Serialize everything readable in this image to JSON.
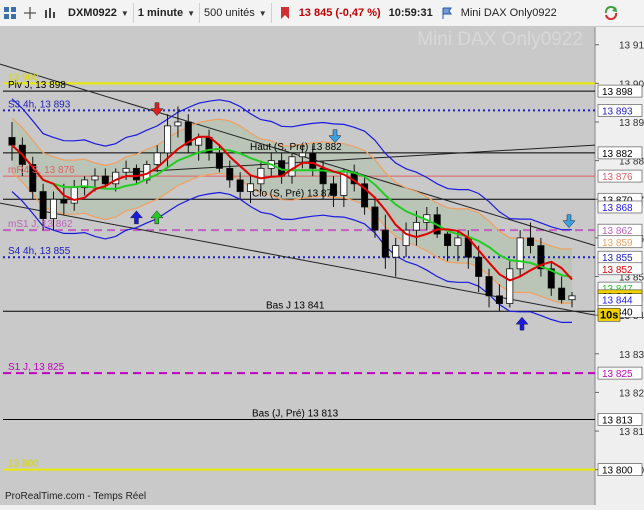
{
  "toolbar": {
    "symbol": "DXM0922",
    "timeframe": "1 minute",
    "units": "500 unités",
    "price": "13 845",
    "change": "(-0,47 %)",
    "time": "10:59:31",
    "instrument": "Mini DAX Only0922",
    "icons": [
      "grid-icon",
      "crosshair-icon",
      "bars-icon",
      "bookmark-icon",
      "refresh-icon"
    ]
  },
  "chart": {
    "watermark": "Mini DAX Only0922",
    "footer": "ProRealTime.com - Temps Réel",
    "timer": "10s",
    "colors": {
      "background": "#c9c9c9",
      "axis_bg": "#efefef",
      "candle_up": "#ffffff",
      "candle_down": "#000000",
      "ma_red": "#e00000",
      "ma_green": "#22cc22",
      "band_blue": "#1a1ae0",
      "band_orange": "#f0a060",
      "cloud": "#b7c4b4",
      "support_line": "#2020c0",
      "magenta_line": "#c000c0",
      "yellow_line": "#ffff40",
      "red_line": "#e06060"
    }
  },
  "chart_data": {
    "type": "candlestick",
    "ylim": [
      13795,
      13912
    ],
    "price_ticks": [
      13910,
      13900,
      13890,
      13880,
      13870,
      13860,
      13850,
      13840,
      13830,
      13820,
      13810,
      13800
    ],
    "levels": [
      {
        "name": "Piv J",
        "label": "Piv J, 13 898",
        "value": 13898,
        "color": "#000000",
        "style": "solid",
        "axis_label": "13 898"
      },
      {
        "name": "R top",
        "label": "13 900",
        "value": 13900,
        "color": "#e8e800",
        "style": "solid",
        "axis_label": ""
      },
      {
        "name": "S3 4h",
        "label": "S3 4h, 13 893",
        "value": 13893,
        "color": "#2020c0",
        "style": "dotted",
        "axis_label": "13 893"
      },
      {
        "name": "Haut (S, Pré)",
        "label": "Haut (S, Pré) 13 882",
        "value": 13882,
        "color": "#000000",
        "style": "solid",
        "axis_label": "13 882"
      },
      {
        "name": "mR4",
        "label": "mR4 S, 13 876",
        "value": 13876,
        "color": "#e06060",
        "style": "solid",
        "axis_label": "13 876"
      },
      {
        "name": "Clo (S, Pré)",
        "label": "Clo (S, Pré) 13 870",
        "value": 13870,
        "color": "#000000",
        "style": "solid",
        "axis_label": "13 870"
      },
      {
        "name": "mS1",
        "label": "mS1 J, 13 862",
        "value": 13862,
        "color": "#c060c0",
        "style": "dashed",
        "axis_label": "13 862"
      },
      {
        "name": "S4 4h",
        "label": "S4 4h, 13 855",
        "value": 13855,
        "color": "#2020c0",
        "style": "dotted",
        "axis_label": "13 855"
      },
      {
        "name": "Bas J",
        "label": "Bas J 13 841",
        "value": 13841,
        "color": "#000000",
        "style": "solid",
        "axis_label": "13 840"
      },
      {
        "name": "S1 J",
        "label": "S1 J, 13 825",
        "value": 13825,
        "color": "#c000c0",
        "style": "dashed",
        "axis_label": "13 825"
      },
      {
        "name": "Bas (J, Pré)",
        "label": "Bas (J, Pré) 13 813",
        "value": 13813,
        "color": "#000000",
        "style": "solid",
        "axis_label": "13 813"
      },
      {
        "name": "Y bottom",
        "label": "13 800",
        "value": 13800,
        "color": "#e8e800",
        "style": "solid",
        "axis_label": "13 800"
      }
    ],
    "side_labels": [
      {
        "value": 13868,
        "text": "13 868",
        "color": "#1a1ae0"
      },
      {
        "value": 13859,
        "text": "13 859",
        "color": "#f0a060"
      },
      {
        "value": 13852,
        "text": "13 852",
        "color": "#e00000"
      },
      {
        "value": 13847,
        "text": "13 847",
        "color": "#22cc22"
      },
      {
        "value": 13845,
        "text": "13 845",
        "color": "#f0d000"
      },
      {
        "value": 13844,
        "text": "13 844",
        "color": "#1a1ae0"
      }
    ],
    "candles": [
      [
        13886,
        13890,
        13880,
        13884
      ],
      [
        13884,
        13886,
        13876,
        13879
      ],
      [
        13879,
        13881,
        13870,
        13872
      ],
      [
        13872,
        13874,
        13862,
        13865
      ],
      [
        13865,
        13872,
        13862,
        13870
      ],
      [
        13870,
        13874,
        13866,
        13869
      ],
      [
        13869,
        13875,
        13867,
        13873
      ],
      [
        13873,
        13876,
        13871,
        13875
      ],
      [
        13875,
        13878,
        13872,
        13876
      ],
      [
        13876,
        13878,
        13873,
        13874
      ],
      [
        13874,
        13878,
        13872,
        13877
      ],
      [
        13877,
        13880,
        13875,
        13878
      ],
      [
        13878,
        13879,
        13874,
        13875
      ],
      [
        13875,
        13880,
        13874,
        13879
      ],
      [
        13879,
        13884,
        13877,
        13882
      ],
      [
        13882,
        13892,
        13878,
        13889
      ],
      [
        13889,
        13894,
        13886,
        13890
      ],
      [
        13890,
        13892,
        13882,
        13884
      ],
      [
        13884,
        13887,
        13880,
        13886
      ],
      [
        13886,
        13888,
        13880,
        13882
      ],
      [
        13882,
        13884,
        13877,
        13878
      ],
      [
        13878,
        13880,
        13873,
        13875
      ],
      [
        13875,
        13877,
        13870,
        13872
      ],
      [
        13872,
        13876,
        13869,
        13874
      ],
      [
        13874,
        13880,
        13872,
        13878
      ],
      [
        13878,
        13882,
        13876,
        13880
      ],
      [
        13880,
        13882,
        13874,
        13876
      ],
      [
        13876,
        13882,
        13874,
        13881
      ],
      [
        13881,
        13884,
        13878,
        13882
      ],
      [
        13882,
        13884,
        13876,
        13878
      ],
      [
        13878,
        13880,
        13870,
        13874
      ],
      [
        13874,
        13876,
        13868,
        13871
      ],
      [
        13871,
        13878,
        13868,
        13877
      ],
      [
        13877,
        13879,
        13872,
        13874
      ],
      [
        13874,
        13876,
        13866,
        13868
      ],
      [
        13868,
        13870,
        13860,
        13862
      ],
      [
        13862,
        13866,
        13852,
        13855
      ],
      [
        13855,
        13860,
        13850,
        13858
      ],
      [
        13858,
        13864,
        13855,
        13862
      ],
      [
        13862,
        13867,
        13858,
        13864
      ],
      [
        13864,
        13868,
        13862,
        13866
      ],
      [
        13866,
        13868,
        13860,
        13861
      ],
      [
        13861,
        13862,
        13854,
        13858
      ],
      [
        13858,
        13862,
        13854,
        13860
      ],
      [
        13860,
        13862,
        13852,
        13855
      ],
      [
        13855,
        13858,
        13846,
        13850
      ],
      [
        13850,
        13852,
        13842,
        13845
      ],
      [
        13845,
        13848,
        13841,
        13843
      ],
      [
        13843,
        13854,
        13842,
        13852
      ],
      [
        13852,
        13862,
        13850,
        13860
      ],
      [
        13860,
        13864,
        13856,
        13858
      ],
      [
        13858,
        13860,
        13850,
        13852
      ],
      [
        13852,
        13854,
        13845,
        13847
      ],
      [
        13847,
        13850,
        13843,
        13844
      ],
      [
        13844,
        13846,
        13842,
        13845
      ]
    ]
  }
}
